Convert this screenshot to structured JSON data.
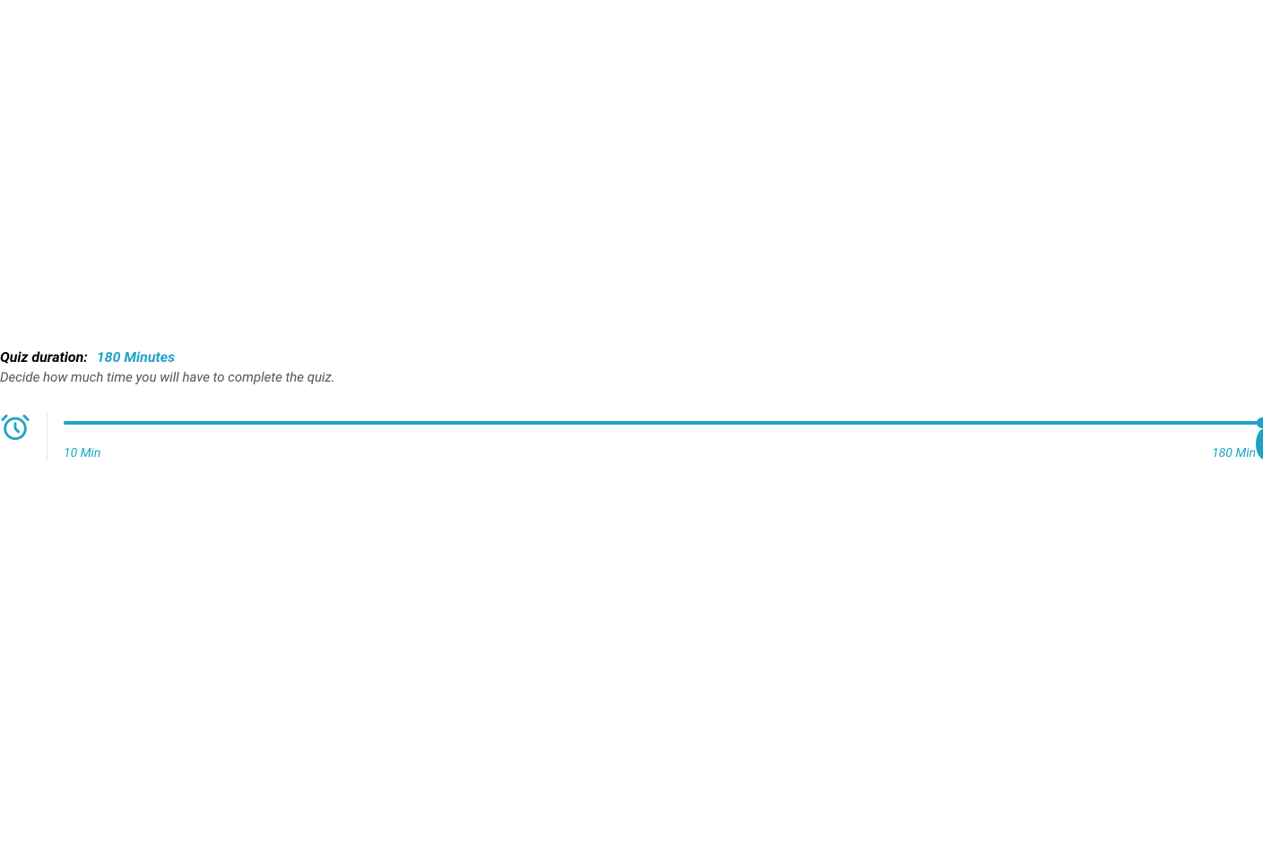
{
  "panel": {
    "label": "Quiz duration:",
    "value": "180 Minutes",
    "description": "Decide how much time you will have to complete the quiz."
  },
  "slider": {
    "min_label": "10 Min",
    "max_label": "180 Min",
    "min": 10,
    "max": 180,
    "current": 180
  },
  "colors": {
    "accent": "#1fa3c4"
  }
}
